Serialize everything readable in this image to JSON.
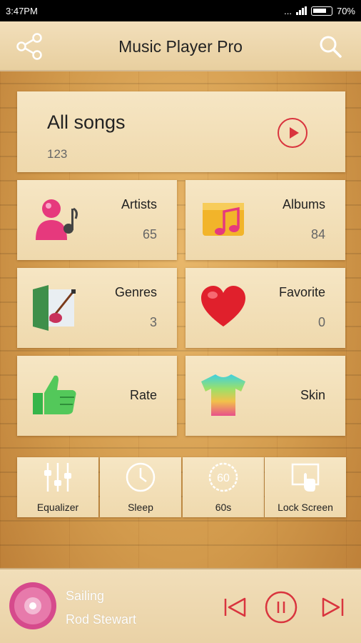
{
  "status_bar": {
    "time": "3:47PM",
    "network": "...",
    "battery": "70%"
  },
  "app_bar": {
    "title": "Music Player Pro",
    "share_icon": "share-icon",
    "search_icon": "search-icon"
  },
  "all_songs": {
    "label": "All songs",
    "count": "123",
    "play_icon": "play-circle-icon"
  },
  "library": [
    {
      "label": "Artists",
      "count": "65",
      "icon": "artists-icon"
    },
    {
      "label": "Albums",
      "count": "84",
      "icon": "albums-icon"
    },
    {
      "label": "Genres",
      "count": "3",
      "icon": "genres-icon"
    },
    {
      "label": "Favorite",
      "count": "0",
      "icon": "heart-icon"
    },
    {
      "label": "Rate",
      "icon": "thumbs-up-icon"
    },
    {
      "label": "Skin",
      "icon": "tshirt-icon"
    }
  ],
  "tools": [
    {
      "label": "Equalizer",
      "icon": "equalizer-icon"
    },
    {
      "label": "Sleep",
      "icon": "clock-icon"
    },
    {
      "label": "60s",
      "icon": "sixty-seconds-icon",
      "icon_text": "60"
    },
    {
      "label": "Lock Screen",
      "icon": "lock-screen-icon"
    }
  ],
  "now_playing": {
    "song": "Sailing",
    "artist": "Rod Stewart",
    "controls": [
      "previous-icon",
      "pause-icon",
      "next-icon"
    ]
  },
  "colors": {
    "accent": "#d9343e",
    "wood": "#d29a4c",
    "panel": "#f3e2bf"
  }
}
